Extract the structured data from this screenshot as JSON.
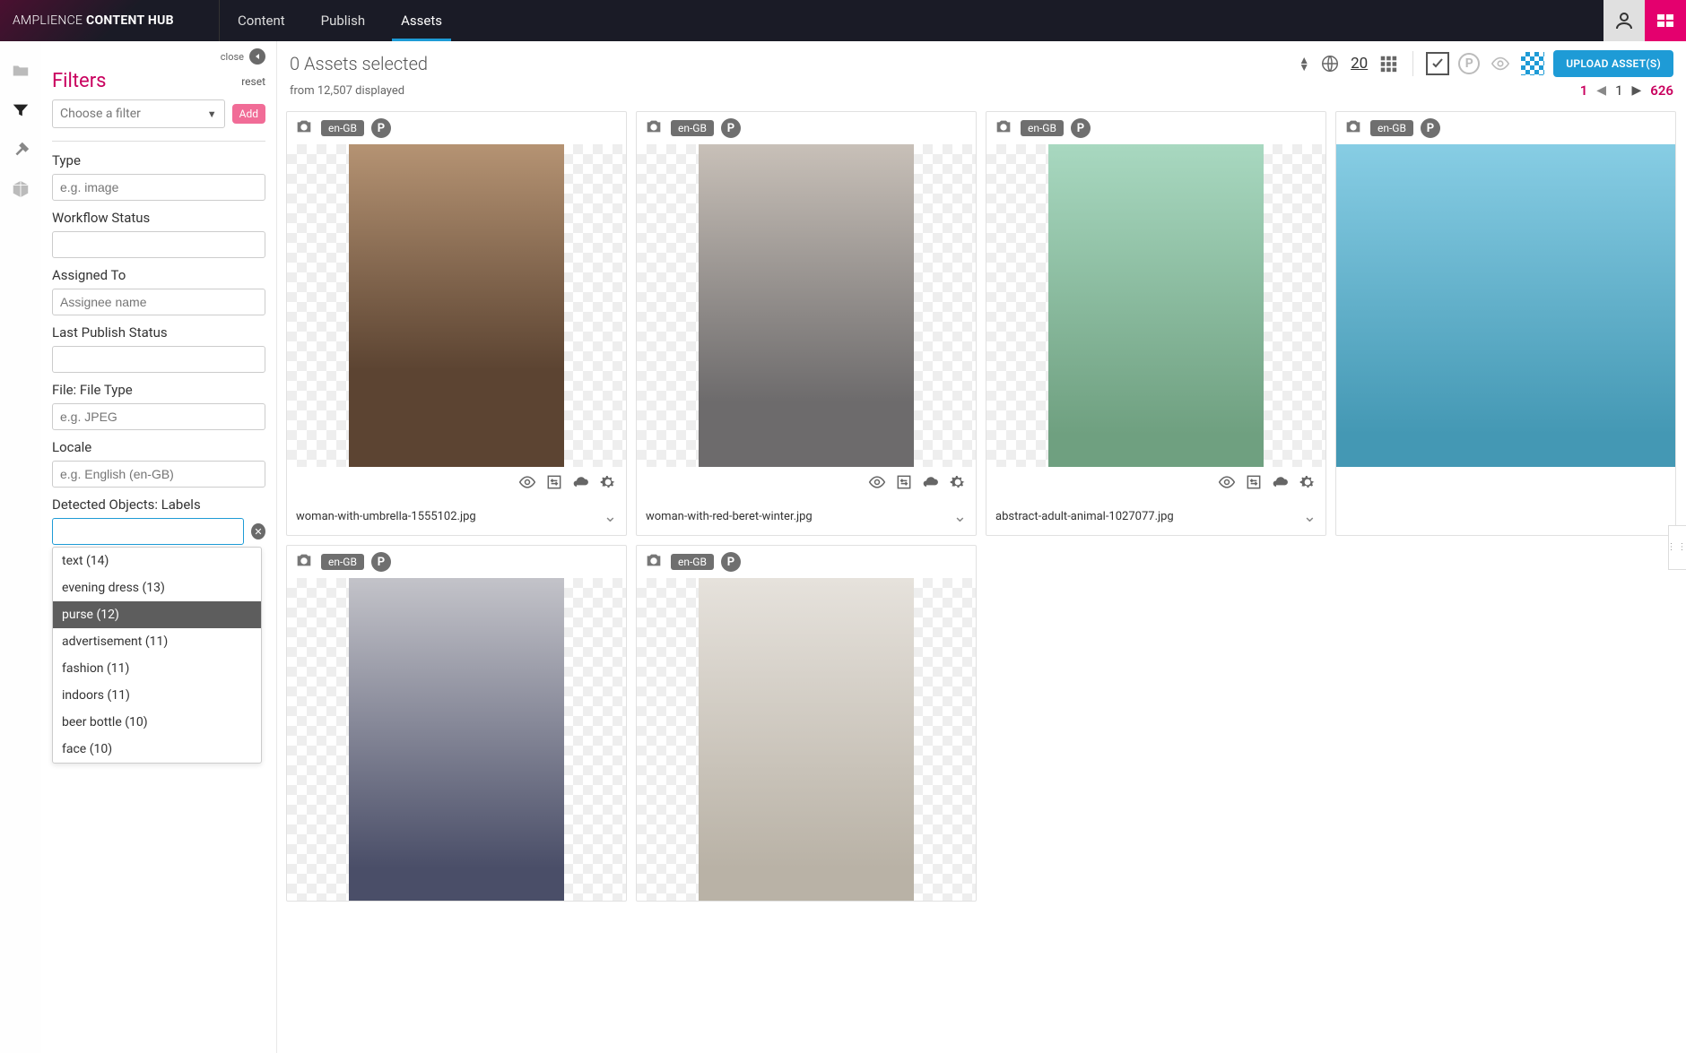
{
  "brand": {
    "thin": "AMPLIENCE ",
    "bold": "CONTENT HUB"
  },
  "nav": {
    "tabs": [
      "Content",
      "Publish",
      "Assets"
    ],
    "active_index": 2
  },
  "filters": {
    "close_label": "close",
    "title": "Filters",
    "reset_label": "reset",
    "choose_placeholder": "Choose a filter",
    "add_label": "Add",
    "groups": {
      "type": {
        "label": "Type",
        "placeholder": "e.g. image"
      },
      "workflow": {
        "label": "Workflow Status"
      },
      "assigned": {
        "label": "Assigned To",
        "placeholder": "Assignee name"
      },
      "lastpub": {
        "label": "Last Publish Status"
      },
      "filetype": {
        "label": "File: File Type",
        "placeholder": "e.g. JPEG"
      },
      "locale": {
        "label": "Locale",
        "placeholder": "e.g. English (en-GB)"
      },
      "detected": {
        "label": "Detected Objects: Labels"
      }
    },
    "dropdown_items": [
      "text (14)",
      "evening dress (13)",
      "purse (12)",
      "advertisement (11)",
      "fashion (11)",
      "indoors (11)",
      "beer bottle (10)",
      "face (10)"
    ],
    "dropdown_highlight_index": 2
  },
  "main": {
    "selected_text": "0 Assets selected",
    "displayed_text": "from 12,507 displayed",
    "page_size": "20",
    "upload_label": "UPLOAD ASSET(S)",
    "pagination": {
      "current": "1",
      "of": "1",
      "total": "626"
    },
    "locale_badge": "en-GB",
    "p_badge": "P",
    "assets": [
      {
        "filename": "woman-with-umbrella-1555102.jpg",
        "thumb_class": "t1"
      },
      {
        "filename": "woman-with-red-beret-winter.jpg",
        "thumb_class": "t2"
      },
      {
        "filename": "abstract-adult-animal-1027077.jpg",
        "thumb_class": "t3"
      },
      {
        "filename": "",
        "thumb_class": "t4"
      },
      {
        "filename": "",
        "thumb_class": "t5"
      },
      {
        "filename": "",
        "thumb_class": "t6"
      }
    ]
  }
}
